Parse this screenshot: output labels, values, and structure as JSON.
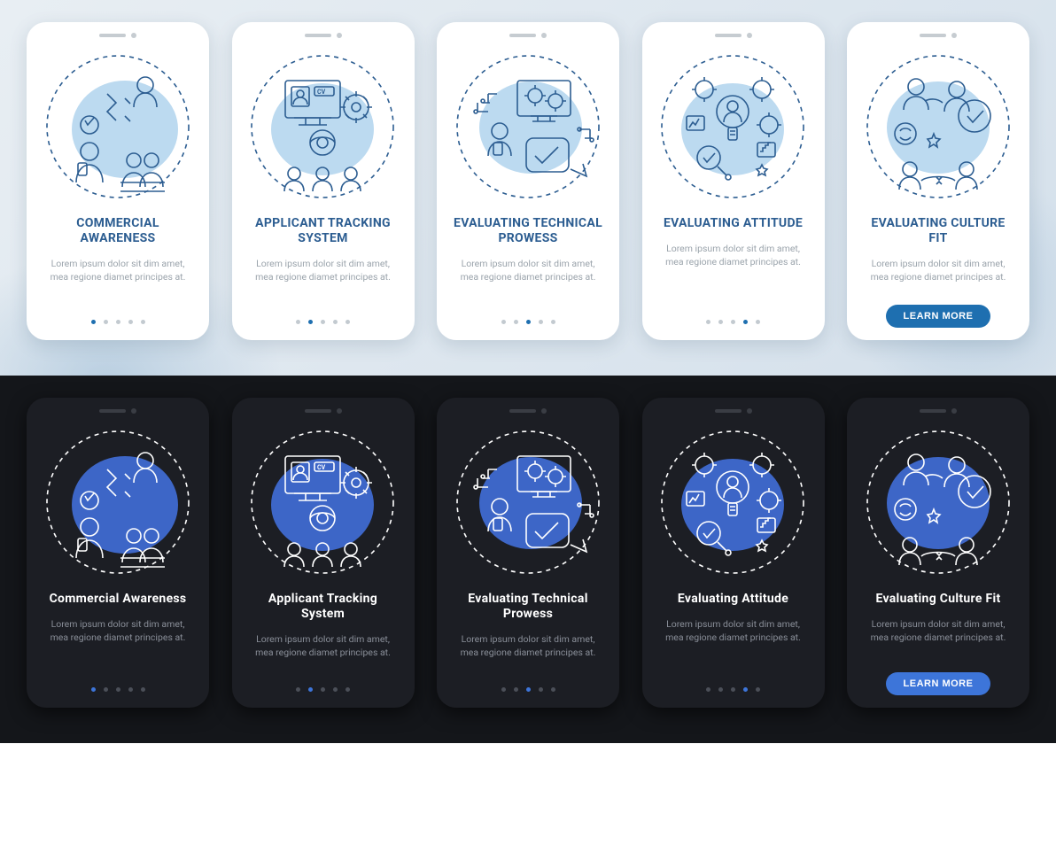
{
  "lorem": "Lorem ipsum dolor sit dim amet, mea regione diamet principes at.",
  "cta_label": "LEARN MORE",
  "colors": {
    "light_accent": "#2c5d91",
    "light_fill": "#bcdaf0",
    "dark_accent": "#3d75d9",
    "dark_bg": "#1c1e24"
  },
  "light": {
    "cards": [
      {
        "title": "COMMERCIAL AWARENESS",
        "active_index": 0,
        "dots": 5,
        "has_cta": false,
        "icon": "commercial-awareness"
      },
      {
        "title": "APPLICANT TRACKING SYSTEM",
        "active_index": 1,
        "dots": 5,
        "has_cta": false,
        "icon": "applicant-tracking"
      },
      {
        "title": "EVALUATING TECHNICAL PROWESS",
        "active_index": 2,
        "dots": 5,
        "has_cta": false,
        "icon": "technical-prowess"
      },
      {
        "title": "EVALUATING ATTITUDE",
        "active_index": 3,
        "dots": 5,
        "has_cta": false,
        "icon": "evaluating-attitude"
      },
      {
        "title": "EVALUATING CULTURE FIT",
        "active_index": 4,
        "dots": 5,
        "has_cta": true,
        "icon": "culture-fit"
      }
    ]
  },
  "dark": {
    "cards": [
      {
        "title": "Commercial Awareness",
        "active_index": 0,
        "dots": 5,
        "has_cta": false,
        "icon": "commercial-awareness"
      },
      {
        "title": "Applicant Tracking System",
        "active_index": 1,
        "dots": 5,
        "has_cta": false,
        "icon": "applicant-tracking"
      },
      {
        "title": "Evaluating Technical Prowess",
        "active_index": 2,
        "dots": 5,
        "has_cta": false,
        "icon": "technical-prowess"
      },
      {
        "title": "Evaluating Attitude",
        "active_index": 3,
        "dots": 5,
        "has_cta": false,
        "icon": "evaluating-attitude"
      },
      {
        "title": "Evaluating Culture Fit",
        "active_index": 4,
        "dots": 5,
        "has_cta": true,
        "icon": "culture-fit"
      }
    ]
  }
}
